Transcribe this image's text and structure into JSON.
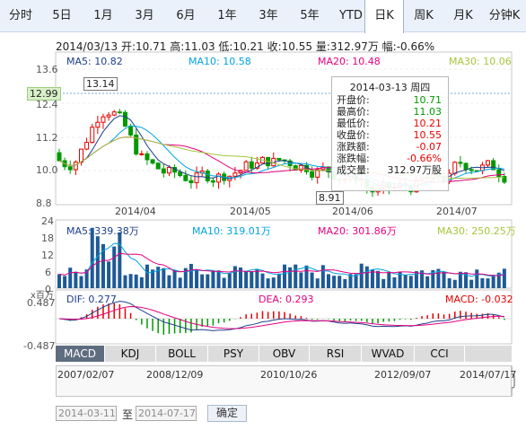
{
  "tabs": [
    {
      "label": "分时"
    },
    {
      "label": "5日"
    },
    {
      "label": "1月"
    },
    {
      "label": "3月"
    },
    {
      "label": "6月"
    },
    {
      "label": "1年"
    },
    {
      "label": "3年"
    },
    {
      "label": "5年"
    },
    {
      "label": "YTD"
    },
    {
      "label": "日K",
      "active": true
    },
    {
      "label": "周K"
    },
    {
      "label": "月K"
    },
    {
      "label": "分钟K"
    }
  ],
  "info_bar": "2014/03/13 开:10.71 高:11.03 低:10.21 收:10.55 量:312.97万 幅:-0.66%",
  "price_ma": {
    "ma5": "MA5: 10.82",
    "ma10": "MA10: 10.58",
    "ma20": "MA20: 10.48",
    "ma30": "MA30: 10.06"
  },
  "price_axis": [
    "13.6",
    "12.4",
    "11.2",
    "10.0",
    "8.8"
  ],
  "current_price_tag": "12.99",
  "high_marker": "13.14",
  "low_marker": "8.91",
  "date_axis": [
    "2014/04",
    "2014/05",
    "2014/06",
    "2014/07"
  ],
  "tooltip": {
    "title": "2014-03-13 周四",
    "rows": [
      {
        "label": "开盘价:",
        "value": "10.71",
        "color": "#009900"
      },
      {
        "label": "最高价:",
        "value": "11.03",
        "color": "#009900"
      },
      {
        "label": "最低价:",
        "value": "10.21",
        "color": "#e60000"
      },
      {
        "label": "收盘价:",
        "value": "10.55",
        "color": "#e60000"
      },
      {
        "label": "涨跌额:",
        "value": "-0.07",
        "color": "#e60000"
      },
      {
        "label": "涨跌幅:",
        "value": "-0.66%",
        "color": "#e60000"
      },
      {
        "label": "成交量:",
        "value": "312.97万股",
        "color": "#222222"
      }
    ]
  },
  "volume_ma": {
    "ma5": "MA5: 339.38万",
    "ma10": "MA10: 319.01万",
    "ma20": "MA20: 301.86万",
    "ma30": "MA30: 250.25万"
  },
  "volume_axis": [
    "24",
    "18",
    "12",
    "6",
    "0"
  ],
  "macd": {
    "scale_label": "x百万",
    "dif": "DIF: 0.277",
    "dea": "DEA: 0.293",
    "macd": "MACD: -0.032",
    "axis": [
      "0.487",
      "-0.487"
    ]
  },
  "indicator_tabs": [
    {
      "label": "MACD",
      "active": true
    },
    {
      "label": "KDJ"
    },
    {
      "label": "BOLL"
    },
    {
      "label": "PSY"
    },
    {
      "label": "OBV"
    },
    {
      "label": "RSI"
    },
    {
      "label": "WVAD"
    },
    {
      "label": "CCI"
    }
  ],
  "navigator_dates": [
    "2007/02/07",
    "2008/12/09",
    "2010/10/26",
    "2012/09/07",
    "2014/07/17"
  ],
  "date_range": {
    "start": "2014-03-11",
    "end": "2014-07-17",
    "to_label": "至",
    "confirm": "确定"
  },
  "colors": {
    "up": "#e60000",
    "down": "#009900",
    "ma5": "#1c3f8a",
    "ma10": "#00a3e0",
    "ma20": "#e5007f",
    "ma30": "#a6c63a"
  }
}
